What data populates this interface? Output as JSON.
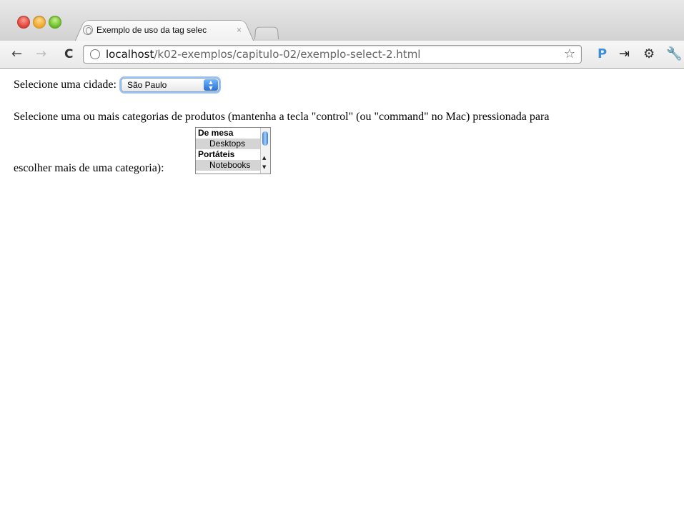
{
  "browser": {
    "tab_title": "Exemplo de uso da tag selec",
    "tab_close": "×",
    "url_host": "localhost",
    "url_path": "/k02-exemplos/capitulo-02/exemplo-select-2.html",
    "icons": [
      "close-window",
      "minimize-window",
      "maximize-window",
      "back",
      "forward",
      "reload",
      "globe",
      "star",
      "pocket-p",
      "mobile",
      "gear",
      "wrench"
    ]
  },
  "page": {
    "city_label": "Selecione uma cidade:",
    "city_selected": "São Paulo",
    "categories_text_line1": "Selecione uma ou mais categorias de produtos (mantenha a tecla \"control\" (ou \"command\" no Mac) pressionada para",
    "categories_text_line2": "escolher mais de uma categoria):",
    "listbox": {
      "groups": [
        {
          "label": "De mesa",
          "options": [
            "Desktops"
          ]
        },
        {
          "label": "Portáteis",
          "options": [
            "Notebooks"
          ]
        }
      ]
    }
  }
}
